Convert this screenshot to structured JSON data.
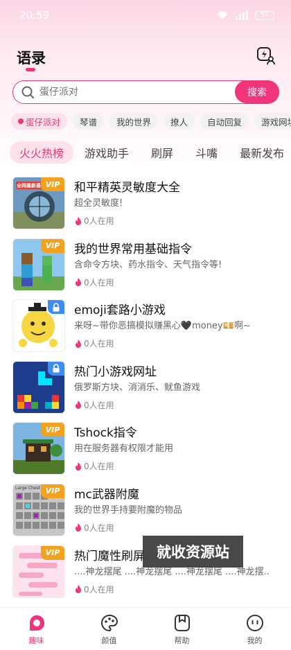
{
  "status_bar": {
    "time": "20:59",
    "battery": "57"
  },
  "header": {
    "title": "语录"
  },
  "search": {
    "placeholder": "蛋仔派对",
    "button_label": "搜索"
  },
  "chips": [
    "蛋仔派对",
    "琴谱",
    "我的世界",
    "撩人",
    "自动回复",
    "游戏网址"
  ],
  "tabs": [
    "火火热榜",
    "游戏助手",
    "刷屏",
    "斗嘴",
    "最新发布"
  ],
  "items": [
    {
      "title": "和平精英灵敏度大全",
      "desc": "超全灵敏度!",
      "meta": "0人在用",
      "badge": "VIP",
      "thumb_label": "全网最新最"
    },
    {
      "title": "我的世界常用基础指令",
      "desc": "含命令方块、药水指令、天气指令等!",
      "meta": "0人在用",
      "badge": "VIP"
    },
    {
      "title": "emoji套路小游戏",
      "desc": "来呀~带你恶搞模拟赚黑心🖤money💴啊~",
      "meta": "0人在用",
      "badge": "lock"
    },
    {
      "title": "热门小游戏网址",
      "desc": "俄罗斯方块、消消乐、鱿鱼游戏",
      "meta": "0人在用",
      "badge": "lock"
    },
    {
      "title": "Tshock指令",
      "desc": "用在服务器有权限才能用",
      "meta": "0人在用",
      "badge": "VIP"
    },
    {
      "title": "mc武器附魔",
      "desc": "我的世界手持要附魔的物品",
      "meta": "0人在用",
      "badge": "VIP",
      "thumb_label": "Large Chest"
    },
    {
      "title": "热门魔性刷屏",
      "desc": "....神龙摆尾 ....神龙摆尾 ....神龙摆尾 ....神龙摆..",
      "meta": "0人在用",
      "badge": "VIP"
    }
  ],
  "watermark": "就收资源站",
  "nav": [
    "趣味",
    "颜值",
    "帮助",
    "我的"
  ],
  "colors": {
    "accent": "#f0357a",
    "vip": "#f3a21d",
    "lock": "#3d8df5"
  }
}
